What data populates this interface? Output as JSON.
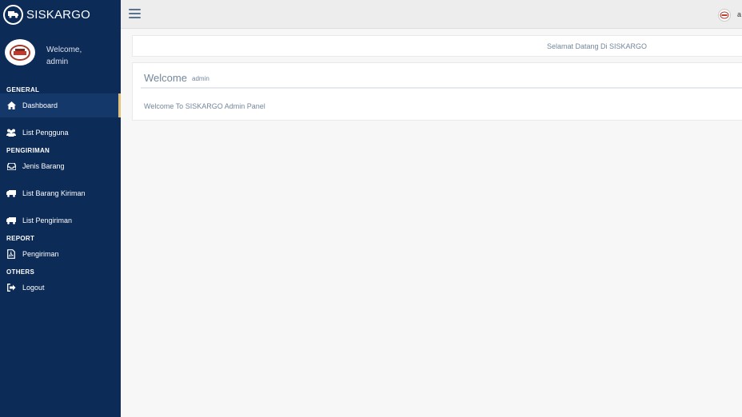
{
  "app": {
    "title": "SISKARGO"
  },
  "profile": {
    "welcome": "Welcome,",
    "name": "admin"
  },
  "sidebar": {
    "sections": [
      {
        "title": "GENERAL"
      },
      {
        "title": "PENGIRIMAN"
      },
      {
        "title": "REPORT"
      },
      {
        "title": "OTHERS"
      }
    ],
    "items": [
      {
        "label": "Dashboard",
        "icon": "home-icon",
        "active": true
      },
      {
        "label": "List Pengguna",
        "icon": "users-icon"
      },
      {
        "label": "Jenis Barang",
        "icon": "inbox-icon"
      },
      {
        "label": "List Barang Kiriman",
        "icon": "truck-icon"
      },
      {
        "label": "List Pengiriman",
        "icon": "truck-icon"
      },
      {
        "label": "Pengiriman",
        "icon": "pdf-file-icon"
      },
      {
        "label": "Logout",
        "icon": "sign-out-icon"
      }
    ]
  },
  "topbar": {
    "user": "a"
  },
  "banner": {
    "text": "Selamat Datang Di SISKARGO"
  },
  "panel": {
    "title": "Welcome",
    "subtitle": "admin",
    "body": "Welcome To SISKARGO Admin Panel"
  },
  "colors": {
    "sidebar": "#0d2b57",
    "active_item": "#15386a",
    "active_border": "#e2c17b",
    "text_muted": "#73879c"
  }
}
